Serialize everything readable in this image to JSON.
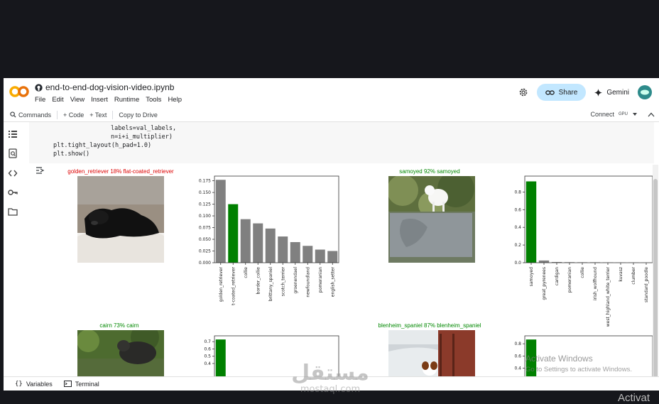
{
  "notebook": {
    "file_name": "end-to-end-dog-vision-video.ipynb",
    "menu": [
      "File",
      "Edit",
      "View",
      "Insert",
      "Runtime",
      "Tools",
      "Help"
    ],
    "share_label": "Share",
    "gemini_label": "Gemini"
  },
  "toolbar": {
    "commands_label": "Commands",
    "code_label": "+ Code",
    "text_label": "+ Text",
    "copy_label": "Copy to Drive",
    "connect_label": "Connect",
    "gpu_label": "GPU"
  },
  "code_lines": [
    "labels=val_labels,",
    "n=i+i_multiplier)",
    "plt.tight_layout(h_pad=1.0)",
    "plt.show()"
  ],
  "captions": [
    {
      "text": "golden_retriever 18% flat-coated_retriever",
      "color": "#dd0000"
    },
    {
      "text": "samoyed 92% samoyed",
      "color": "#008800"
    },
    {
      "text": "cairn 73% cairn",
      "color": "#008800"
    },
    {
      "text": "blenheim_spaniel 87% blenheim_spaniel",
      "color": "#008800"
    }
  ],
  "chart_data": [
    {
      "type": "bar",
      "categories": [
        "golden_retriever",
        "flat-coated_retriever",
        "collie",
        "border_collie",
        "brittany_spaniel",
        "scotch_terrier",
        "groenendael",
        "newfoundland",
        "pomeranian",
        "english_setter"
      ],
      "values": [
        0.177,
        0.125,
        0.093,
        0.084,
        0.073,
        0.056,
        0.044,
        0.036,
        0.028,
        0.025
      ],
      "highlight_index": 1,
      "ylim": [
        0,
        0.185
      ],
      "yticks": [
        "0.000",
        "0.025",
        "0.050",
        "0.075",
        "0.100",
        "0.125",
        "0.150",
        "0.175"
      ]
    },
    {
      "type": "bar",
      "categories": [
        "samoyed",
        "great_pyrenees",
        "cardigan",
        "pomeranian",
        "collie",
        "irish_wolfhound",
        "west_highland_white_terrier",
        "kuvasz",
        "clumber",
        "standard_poodle"
      ],
      "values": [
        0.92,
        0.025,
        0.008,
        0.006,
        0.005,
        0.005,
        0.004,
        0.003,
        0.003,
        0.002
      ],
      "highlight_index": 0,
      "ylim": [
        0,
        0.98
      ],
      "yticks": [
        "0.0",
        "0.2",
        "0.4",
        "0.6",
        "0.8"
      ]
    },
    {
      "type": "bar",
      "categories": [],
      "values": [
        0.73
      ],
      "highlight_index": 0,
      "ylim": [
        0,
        0.78
      ],
      "yticks": [
        "0.4",
        "0.5",
        "0.6",
        "0.7"
      ]
    },
    {
      "type": "bar",
      "categories": [],
      "values": [
        0.87
      ],
      "highlight_index": 0,
      "ylim": [
        0,
        0.93
      ],
      "yticks": [
        "0.4",
        "0.6",
        "0.8"
      ]
    }
  ],
  "status": {
    "variables_label": "Variables",
    "terminal_label": "Terminal"
  },
  "watermark": {
    "title": "Activate Windows",
    "subtitle": "Go to Settings to activate Windows.",
    "corner": "Activat",
    "stamp_text": "مستقل",
    "stamp_sub": "mostaql.com"
  },
  "colors": {
    "highlight_bar": "#008000",
    "bar": "#808080",
    "share_bg": "#c2e7ff",
    "wrong": "#dd0000",
    "right": "#008800"
  }
}
